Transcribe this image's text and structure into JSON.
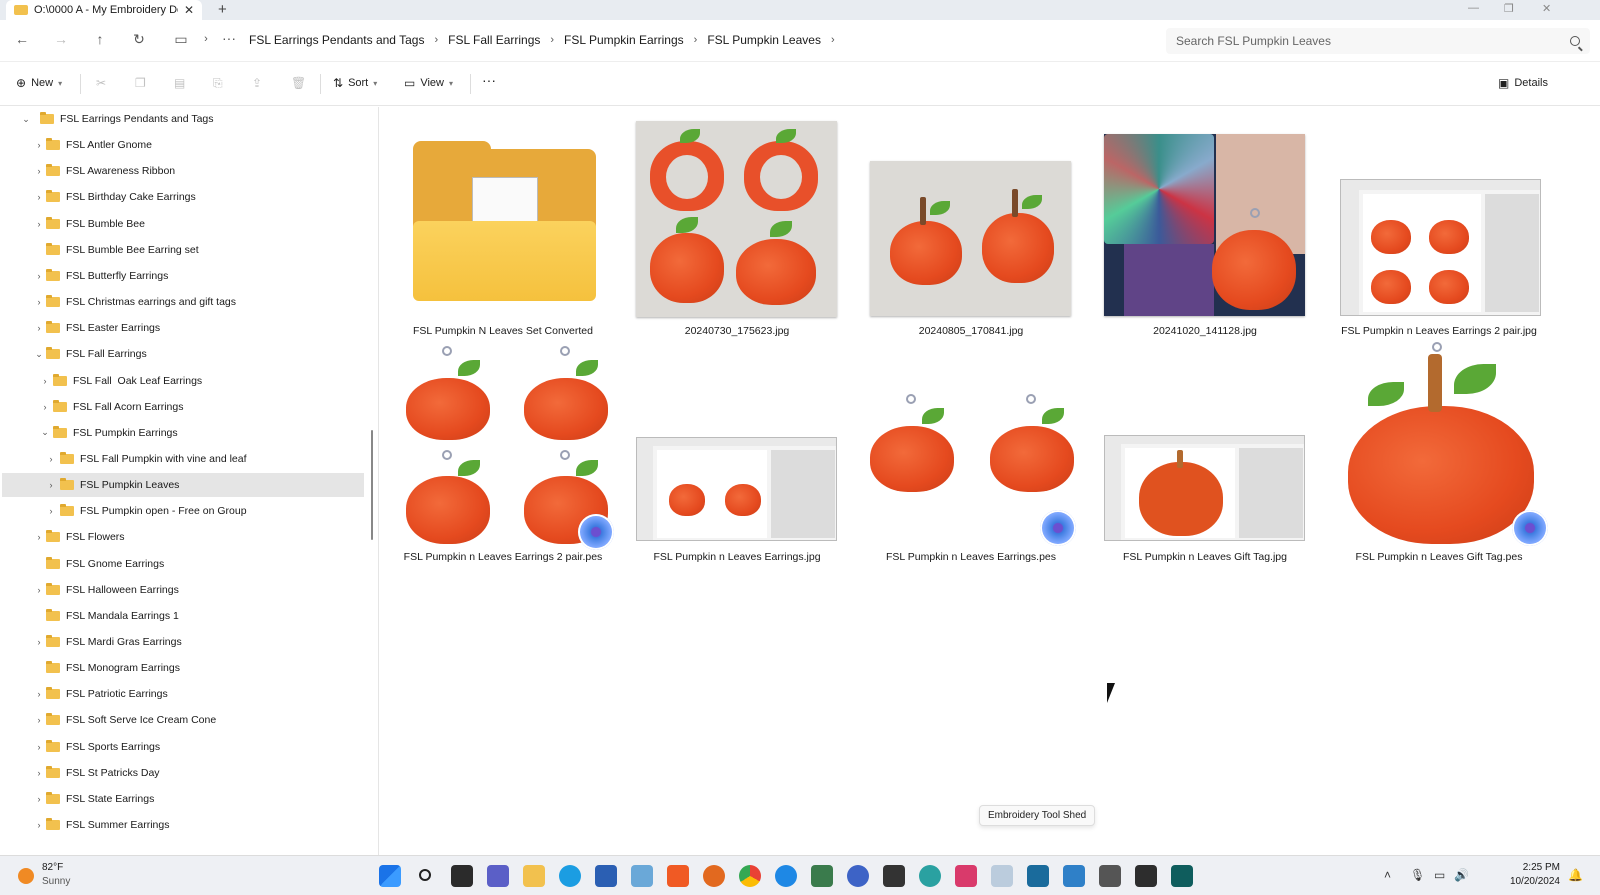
{
  "window": {
    "tab_title": "O:\\0000 A - My Embroidery De"
  },
  "address": {
    "breadcrumbs": [
      "FSL Earrings Pendants and Tags",
      "FSL Fall Earrings",
      "FSL Pumpkin Earrings",
      "FSL Pumpkin Leaves"
    ],
    "search_placeholder": "Search FSL Pumpkin Leaves"
  },
  "toolbar": {
    "new_label": "New",
    "sort_label": "Sort",
    "view_label": "View",
    "details_label": "Details"
  },
  "sidebar": {
    "items": [
      {
        "label": "FSL Earrings Pendants and Tags",
        "level": 0,
        "expanded": true,
        "has_children": true
      },
      {
        "label": "FSL Antler Gnome",
        "level": 1,
        "has_children": true
      },
      {
        "label": "FSL Awareness Ribbon",
        "level": 1,
        "has_children": true
      },
      {
        "label": "FSL Birthday Cake Earrings",
        "level": 1,
        "has_children": true
      },
      {
        "label": "FSL Bumble Bee",
        "level": 1,
        "has_children": true
      },
      {
        "label": "FSL Bumble Bee Earring set",
        "level": 1,
        "has_children": false
      },
      {
        "label": "FSL Butterfly Earrings",
        "level": 1,
        "has_children": true
      },
      {
        "label": "FSL Christmas earrings and gift tags",
        "level": 1,
        "has_children": true
      },
      {
        "label": "FSL Easter Earrings",
        "level": 1,
        "has_children": true
      },
      {
        "label": "FSL Fall Earrings",
        "level": 1,
        "expanded": true,
        "has_children": true
      },
      {
        "label": "FSL Fall  Oak Leaf Earrings",
        "level": 2,
        "has_children": true
      },
      {
        "label": "FSL Fall Acorn Earrings",
        "level": 2,
        "has_children": true
      },
      {
        "label": "FSL Pumpkin Earrings",
        "level": 2,
        "expanded": true,
        "has_children": true
      },
      {
        "label": "FSL Fall Pumpkin with vine and leaf",
        "level": 3,
        "has_children": true
      },
      {
        "label": "FSL Pumpkin Leaves",
        "level": 3,
        "has_children": true,
        "selected": true
      },
      {
        "label": "FSL Pumpkin open - Free on Group",
        "level": 3,
        "has_children": true
      },
      {
        "label": "FSL Flowers",
        "level": 1,
        "has_children": true
      },
      {
        "label": "FSL Gnome Earrings",
        "level": 1,
        "has_children": false
      },
      {
        "label": "FSL Halloween Earrings",
        "level": 1,
        "has_children": true
      },
      {
        "label": "FSL Mandala Earrings 1",
        "level": 1,
        "has_children": false
      },
      {
        "label": "FSL Mardi Gras Earrings",
        "level": 1,
        "has_children": true
      },
      {
        "label": "FSL Monogram Earrings",
        "level": 1,
        "has_children": false
      },
      {
        "label": "FSL Patriotic Earrings",
        "level": 1,
        "has_children": true
      },
      {
        "label": "FSL Soft Serve Ice Cream Cone",
        "level": 1,
        "has_children": true
      },
      {
        "label": "FSL Sports Earrings",
        "level": 1,
        "has_children": true
      },
      {
        "label": "FSL St Patricks Day",
        "level": 1,
        "has_children": true
      },
      {
        "label": "FSL State Earrings",
        "level": 1,
        "has_children": true
      },
      {
        "label": "FSL Summer Earrings",
        "level": 1,
        "has_children": true
      }
    ]
  },
  "files": [
    {
      "name": "FSL Pumpkin N Leaves Set Converted",
      "kind": "folder"
    },
    {
      "name": "20240730_175623.jpg",
      "kind": "photo-four-pumpkins"
    },
    {
      "name": "20240805_170841.jpg",
      "kind": "photo-two-pumpkins"
    },
    {
      "name": "20241020_141128.jpg",
      "kind": "photo-earring-quilt"
    },
    {
      "name": "FSL Pumpkin n Leaves Earrings 2 pair.jpg",
      "kind": "screenshot-four"
    },
    {
      "name": "FSL Pumpkin n Leaves Earrings 2 pair.pes",
      "kind": "pes-four"
    },
    {
      "name": "FSL Pumpkin n Leaves Earrings.jpg",
      "kind": "screenshot-two"
    },
    {
      "name": "FSL Pumpkin n Leaves Earrings.pes",
      "kind": "pes-two"
    },
    {
      "name": "FSL Pumpkin n Leaves Gift Tag.jpg",
      "kind": "screenshot-one"
    },
    {
      "name": "FSL Pumpkin n Leaves Gift Tag.pes",
      "kind": "pes-one"
    }
  ],
  "tooltip": "Embroidery Tool Shed",
  "taskbar": {
    "temperature": "82°F",
    "condition": "Sunny",
    "time": "2:25 PM",
    "date": "10/20/2024"
  }
}
